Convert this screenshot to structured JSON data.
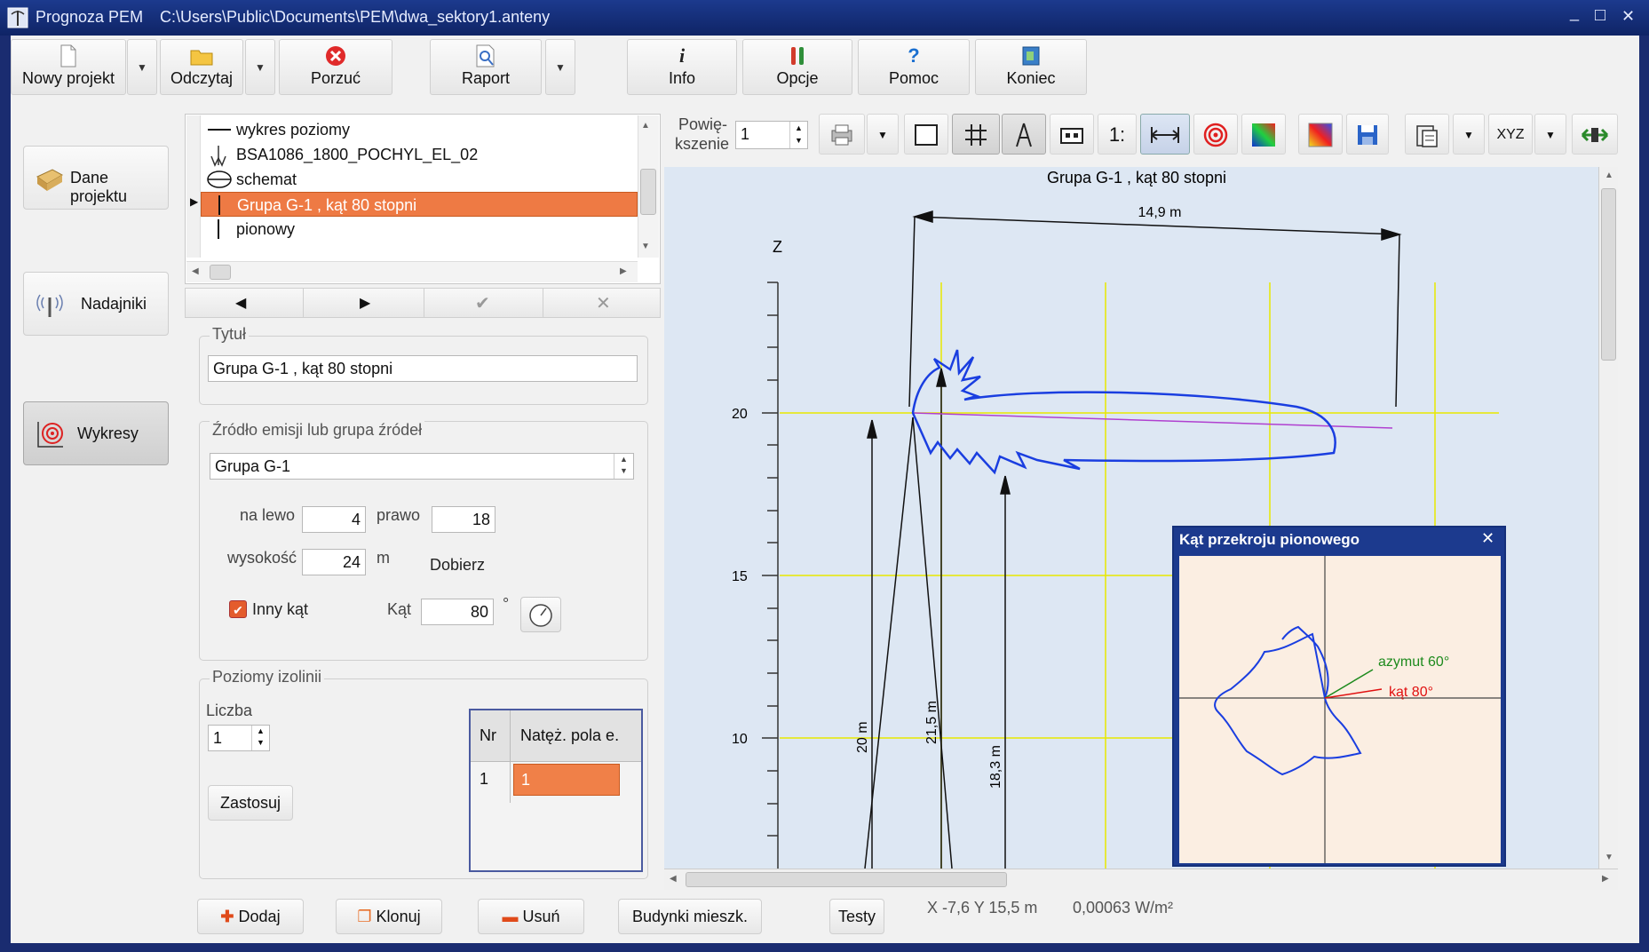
{
  "window": {
    "app_title": "Prognoza PEM",
    "file_path": "C:\\Users\\Public\\Documents\\PEM\\dwa_sektory1.anteny",
    "minimize": "_",
    "maximize": "□",
    "close": "✕"
  },
  "toolbar": {
    "new_project": "Nowy projekt",
    "open": "Odczytaj",
    "discard": "Porzuć",
    "report": "Raport",
    "info": "Info",
    "options": "Opcje",
    "help": "Pomoc",
    "exit": "Koniec",
    "dropdown_glyph": "▼"
  },
  "sidebar": {
    "project_data": "Dane projektu",
    "transmitters": "Nadajniki",
    "charts": "Wykresy"
  },
  "chart_list": {
    "items": [
      {
        "label": "wykres poziomy",
        "icon": "horizontal-line-icon"
      },
      {
        "label": "BSA1086_1800_POCHYL_EL_02",
        "icon": "antenna-icon"
      },
      {
        "label": "schemat",
        "icon": "ellipse-icon"
      },
      {
        "label": "Grupa G-1 , kąt 80 stopni",
        "icon": "vertical-line-icon",
        "selected": true
      },
      {
        "label": "pionowy",
        "icon": "vertical-line-icon"
      }
    ]
  },
  "nav": {
    "prev": "◀",
    "next": "▶",
    "ok": "✔",
    "cancel": "✕"
  },
  "title_group": {
    "label": "Tytuł",
    "value": "Grupa G-1 , kąt 80 stopni"
  },
  "source_group": {
    "label": "Źródło emisji lub grupa źródeł",
    "selected": "Grupa G-1",
    "left_label": "na lewo",
    "left_value": "4",
    "right_label": "prawo",
    "right_value": "18",
    "height_label": "wysokość",
    "height_value": "24",
    "height_unit": "m",
    "adjust": "Dobierz",
    "other_angle": "Inny kąt",
    "angle_label": "Kąt",
    "angle_value": "80",
    "deg": "°"
  },
  "isolines": {
    "label": "Poziomy izolinii",
    "count_label": "Liczba",
    "count_value": "1",
    "apply": "Zastosuj",
    "col_nr": "Nr",
    "col_field": "Natęż. pola e.",
    "rows": [
      {
        "nr": "1",
        "value": "1"
      }
    ]
  },
  "bottom": {
    "add": "Dodaj",
    "clone": "Klonuj",
    "remove": "Usuń",
    "buildings": "Budynki mieszk.",
    "tests": "Testy",
    "coords": "X -7,6 Y 15,5 m",
    "density": "0,00063 W/m²"
  },
  "plot": {
    "zoom_label_1": "Powię-",
    "zoom_label_2": "kszenie",
    "zoom_value": "1",
    "scale_label": "1:",
    "xyz_label": "XYZ",
    "title": "Grupa G-1 , kąt 80 stopni",
    "axis_z": "Z",
    "z_ticks": [
      "20",
      "15",
      "10"
    ],
    "width_dim": "14,9 m",
    "dims": [
      "20 m",
      "21,5 m",
      "18,3 m"
    ],
    "colors": {
      "pattern": "#1a3ee0",
      "grid": "#e6e600",
      "beam": "#b040d0"
    }
  },
  "inset": {
    "title": "Kąt przekroju pionowego",
    "azimuth": "azymut 60°",
    "angle": "kąt 80°",
    "colors": {
      "azimuth": "#1d8a1d",
      "angle": "#e01010",
      "pattern": "#1a3ee0"
    }
  }
}
